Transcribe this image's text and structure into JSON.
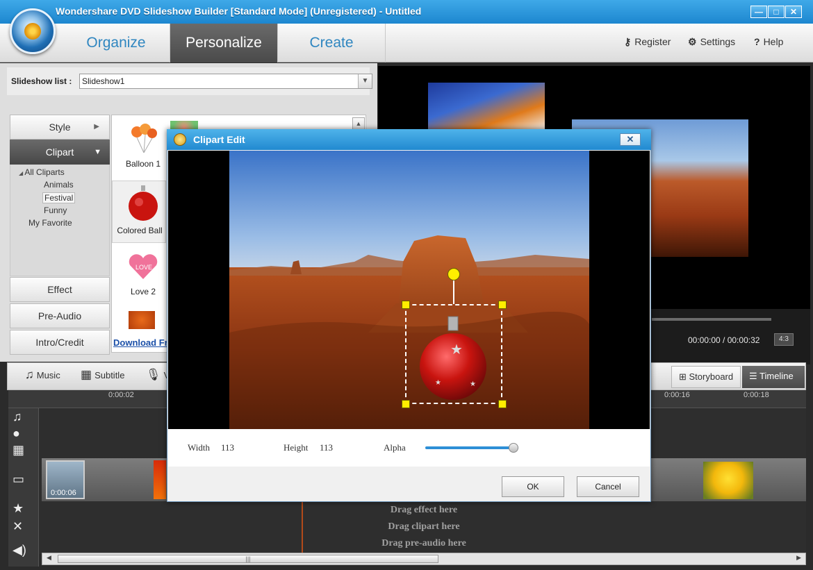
{
  "window": {
    "title": "Wondershare DVD Slideshow Builder [Standard Mode] (Unregistered) - Untitled",
    "controls": {
      "minimize": "—",
      "maximize": "□",
      "close": "✕"
    }
  },
  "nav": {
    "tabs": [
      {
        "label": "Organize",
        "active": false
      },
      {
        "label": "Personalize",
        "active": true
      },
      {
        "label": "Create",
        "active": false
      }
    ],
    "register": "Register",
    "settings": "Settings",
    "help": "Help"
  },
  "slideshow": {
    "label": "Slideshow list :",
    "selected": "Slideshow1"
  },
  "left_menu": {
    "style": "Style",
    "clipart": "Clipart",
    "effect": "Effect",
    "pre_audio": "Pre-Audio",
    "intro_credit": "Intro/Credit"
  },
  "tree": {
    "all": "All Cliparts",
    "animals": "Animals",
    "festival": "Festival",
    "funny": "Funny",
    "favorite": "My Favorite"
  },
  "cliparts": [
    {
      "label": "Balloon 1"
    },
    {
      "label": "Colored Ball"
    },
    {
      "label": "Love 2"
    }
  ],
  "download_link": "Download Fr",
  "player": {
    "timecode": "00:00:00 / 00:00:32",
    "aspect": "4:3"
  },
  "timeline": {
    "music": "Music",
    "subtitle": "Subtitle",
    "voice": "V",
    "storyboard": "Storyboard",
    "timeline": "Timeline",
    "ticks": [
      "0:00:02",
      "0:00:16",
      "0:00:18"
    ],
    "clip_time": "0:00:06",
    "drop_effect": "Drag effect here",
    "drop_clipart": "Drag clipart here",
    "drop_preaudio": "Drag pre-audio here"
  },
  "dialog": {
    "title": "Clipart Edit",
    "width_label": "Width",
    "width_value": "113",
    "height_label": "Height",
    "height_value": "113",
    "alpha_label": "Alpha",
    "alpha_level": 0.95,
    "ok": "OK",
    "cancel": "Cancel"
  }
}
